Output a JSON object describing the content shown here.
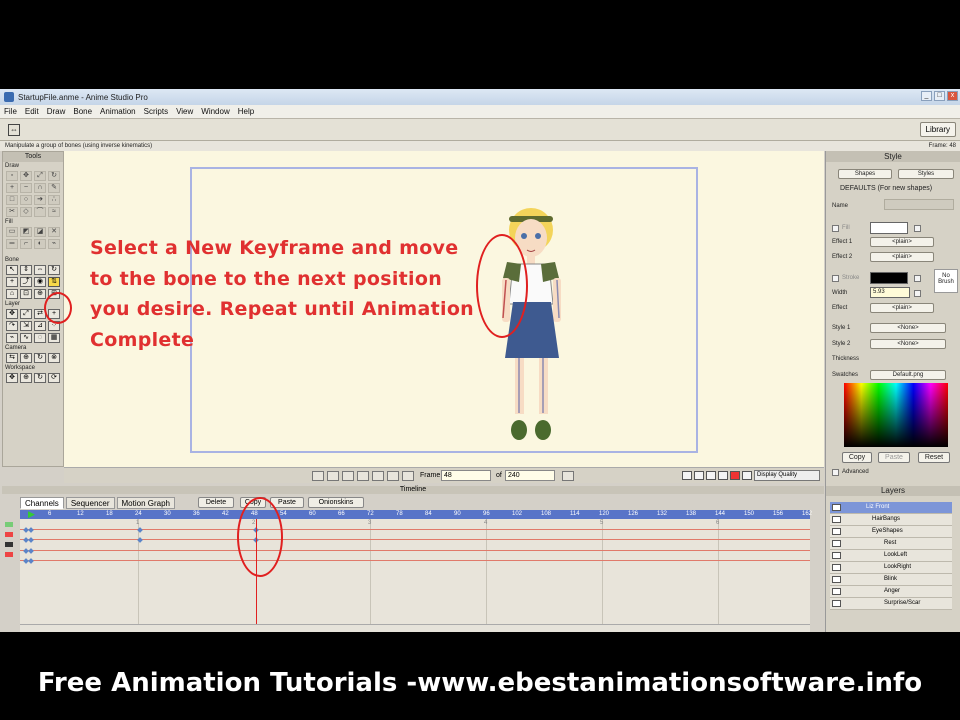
{
  "window": {
    "title": "StartupFile.anme - Anime Studio Pro",
    "controls": [
      "_",
      "□",
      "x"
    ]
  },
  "menu": [
    "File",
    "Edit",
    "Draw",
    "Bone",
    "Animation",
    "Scripts",
    "View",
    "Window",
    "Help"
  ],
  "toolbar": {
    "library_label": "Library"
  },
  "status": {
    "hint": "Manipulate a group of bones (using inverse kinematics)",
    "frame": "Frame: 48"
  },
  "tools_panel": {
    "title": "Tools",
    "sections": [
      "Draw",
      "Fill",
      "Bone",
      "Layer",
      "Camera",
      "Workspace"
    ]
  },
  "instruction_text": "Select a New Keyframe and move to the bone to the next position you desire. Repeat until Animation Complete",
  "canvas_bar": {
    "frame_label": "Frame",
    "frame_value": "48",
    "of_label": "of",
    "total_frames": "240",
    "display_quality": "Display Quality"
  },
  "style_panel": {
    "title": "Style",
    "shapes_btn": "Shapes",
    "styles_btn": "Styles",
    "defaults": "DEFAULTS (For new shapes)",
    "name_label": "Name",
    "fill_label": "Fill",
    "effect1_label": "Effect 1",
    "effect1_value": "<plain>",
    "effect2_label": "Effect 2",
    "effect2_value": "<plain>",
    "stroke_label": "Stroke",
    "no_brush": "No Brush",
    "width_label": "Width",
    "width_value": "5.93",
    "effect_label": "Effect",
    "effect_value": "<plain>",
    "style1_label": "Style 1",
    "style1_value": "<None>",
    "style2_label": "Style 2",
    "style2_value": "<None>",
    "thickness_label": "Thickness",
    "swatches_label": "Swatches",
    "swatches_value": "Default.png",
    "copy_btn": "Copy",
    "paste_btn": "Paste",
    "reset_btn": "Reset",
    "advanced_label": "Advanced",
    "fill_color": "#ffffff",
    "stroke_color": "#000000"
  },
  "timeline": {
    "title": "Timeline",
    "tabs": [
      "Channels",
      "Sequencer",
      "Motion Graph"
    ],
    "delete_btn": "Delete",
    "copy_btn": "Copy",
    "paste_btn": "Paste",
    "onionskins_btn": "Onionskins",
    "ruler_ticks": [
      "0",
      "6",
      "12",
      "18",
      "24",
      "30",
      "36",
      "42",
      "48",
      "54",
      "60",
      "66",
      "72",
      "78",
      "84",
      "90",
      "96",
      "102",
      "108",
      "114",
      "120",
      "126",
      "132",
      "138",
      "144",
      "150",
      "156",
      "162"
    ],
    "current_frame": 48,
    "section_markers": [
      "1",
      "2",
      "3",
      "4",
      "5",
      "6"
    ]
  },
  "layers_panel": {
    "title": "Layers",
    "items": [
      "Liz Front",
      "HairBangs",
      "EyeShapes",
      "Rest",
      "LookLeft",
      "LookRight",
      "Blink",
      "Anger",
      "Surprise/Scar"
    ]
  },
  "banner": "Free Animation Tutorials -www.ebestanimationsoftware.info"
}
